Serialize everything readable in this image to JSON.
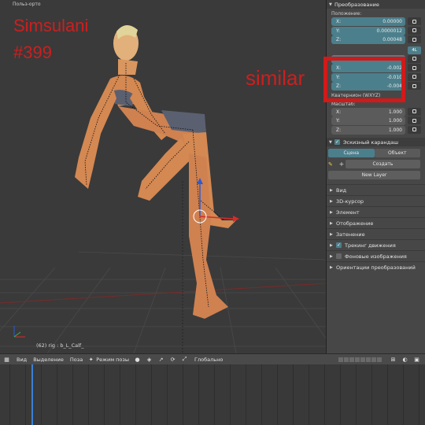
{
  "viewport": {
    "title": "Польз-орто",
    "info": "(62) rig : b_L_Calf_",
    "overlay": {
      "line1": "Simsulani",
      "line2": "#399",
      "note": "similar"
    }
  },
  "panel": {
    "transform_header": "Преобразование",
    "location_label": "Положение:",
    "location": [
      {
        "axis": "X:",
        "value": "0.00000"
      },
      {
        "axis": "Y:",
        "value": "0.0000012"
      },
      {
        "axis": "Z:",
        "value": "0.00048"
      }
    ],
    "mode_button": "4L",
    "rotation": [
      {
        "axis": "W:",
        "value": "1.000"
      },
      {
        "axis": "X:",
        "value": "-0.002"
      },
      {
        "axis": "Y:",
        "value": "-0.010"
      },
      {
        "axis": "Z:",
        "value": "-0.004"
      }
    ],
    "rotation_mode": "Кватернион (WXYZ)",
    "scale_label": "Масштаб:",
    "scale": [
      {
        "axis": "X:",
        "value": "1.000"
      },
      {
        "axis": "Y:",
        "value": "1.000"
      },
      {
        "axis": "Z:",
        "value": "1.000"
      }
    ],
    "gpencil_header": "Эскизный карандаш",
    "tab_scene": "Сцена",
    "tab_object": "Объект",
    "create_button": "Создать",
    "new_layer_button": "New Layer",
    "sections": [
      {
        "label": "Вид",
        "checkbox": null
      },
      {
        "label": "3D-курсор",
        "checkbox": null
      },
      {
        "label": "Элемент",
        "checkbox": null
      },
      {
        "label": "Отображение",
        "checkbox": null
      },
      {
        "label": "Затенение",
        "checkbox": null
      },
      {
        "label": "Трекинг движения",
        "checkbox": "on"
      },
      {
        "label": "Фоновые изображения",
        "checkbox": "off"
      },
      {
        "label": "Ориентации преобразований",
        "checkbox": null
      }
    ]
  },
  "toolbar": {
    "view": "Вид",
    "select": "Выделение",
    "pose": "Поза",
    "mode": "Режим позы",
    "orientation": "Глобально"
  },
  "colors": {
    "accent": "#4c7f8c",
    "highlight_red": "#d11a1a",
    "playhead": "#3c7fd6"
  }
}
